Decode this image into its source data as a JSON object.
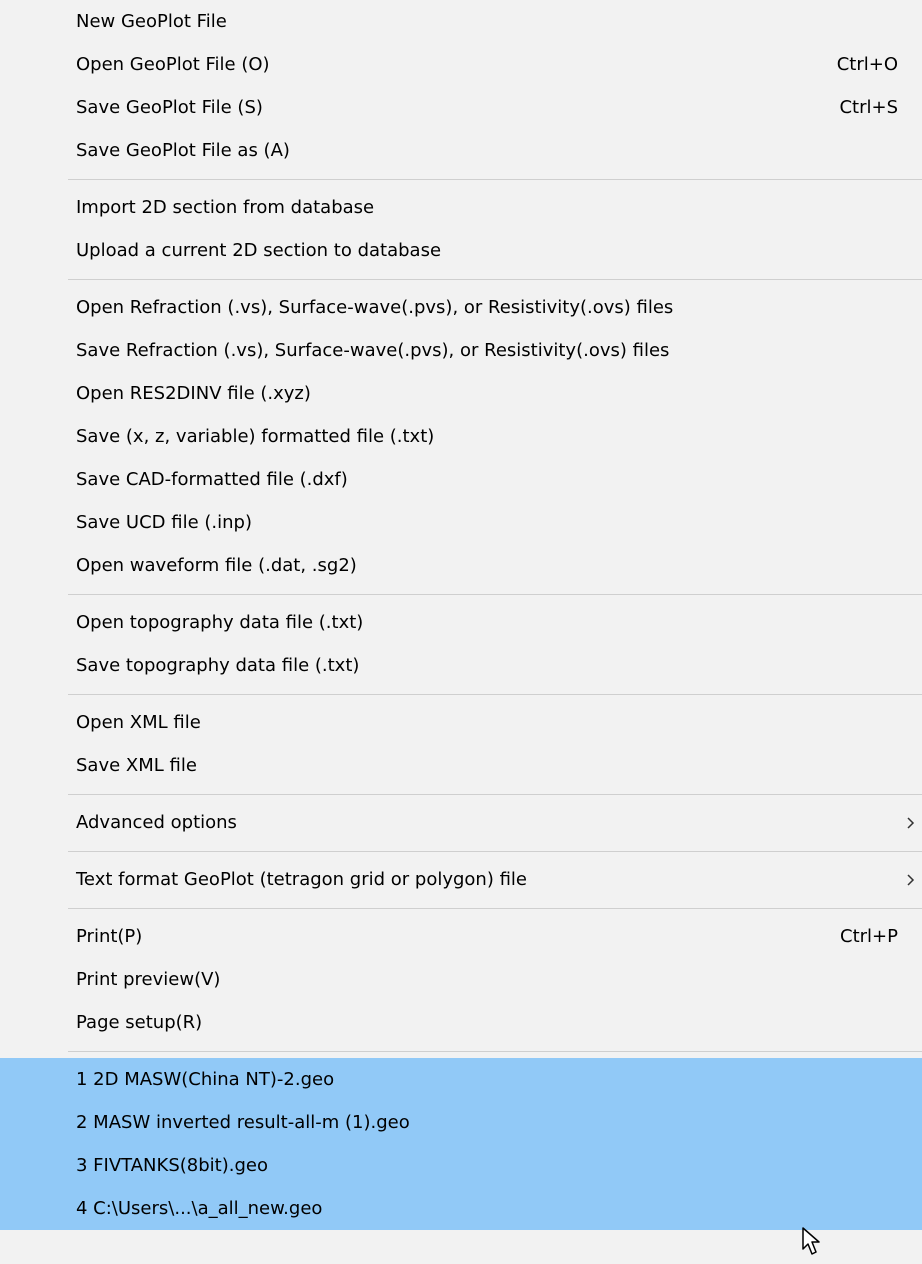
{
  "menu": {
    "items": [
      {
        "label": "New GeoPlot File",
        "shortcut": ""
      },
      {
        "label": "Open GeoPlot File (O)",
        "shortcut": "Ctrl+O"
      },
      {
        "label": "Save GeoPlot File (S)",
        "shortcut": "Ctrl+S"
      },
      {
        "label": "Save GeoPlot File as (A)",
        "shortcut": ""
      },
      {
        "label": "Import 2D section from database",
        "shortcut": ""
      },
      {
        "label": "Upload a current 2D section to database",
        "shortcut": ""
      },
      {
        "label": "Open Refraction (.vs), Surface-wave(.pvs), or Resistivity(.ovs) files",
        "shortcut": ""
      },
      {
        "label": "Save Refraction (.vs), Surface-wave(.pvs), or Resistivity(.ovs) files",
        "shortcut": ""
      },
      {
        "label": "Open RES2DINV file (.xyz)",
        "shortcut": ""
      },
      {
        "label": "Save (x, z, variable) formatted file (.txt)",
        "shortcut": ""
      },
      {
        "label": "Save CAD-formatted file (.dxf)",
        "shortcut": ""
      },
      {
        "label": "Save UCD file (.inp)",
        "shortcut": ""
      },
      {
        "label": "Open waveform file (.dat, .sg2)",
        "shortcut": ""
      },
      {
        "label": "Open topography data file (.txt)",
        "shortcut": ""
      },
      {
        "label": "Save topography data file (.txt)",
        "shortcut": ""
      },
      {
        "label": "Open XML file",
        "shortcut": ""
      },
      {
        "label": "Save XML file",
        "shortcut": ""
      },
      {
        "label": "Advanced options",
        "shortcut": ""
      },
      {
        "label": "Text format GeoPlot (tetragon grid or polygon) file",
        "shortcut": ""
      },
      {
        "label": "Print(P)",
        "shortcut": "Ctrl+P"
      },
      {
        "label": "Print preview(V)",
        "shortcut": ""
      },
      {
        "label": "Page setup(R)",
        "shortcut": ""
      }
    ],
    "recent_files": [
      "1 2D MASW(China NT)-2.geo",
      "2 MASW inverted result-all-m (1).geo",
      "3 FIVTANKS(8bit).geo",
      "4 C:\\Users\\...\\a_all_new.geo"
    ]
  }
}
